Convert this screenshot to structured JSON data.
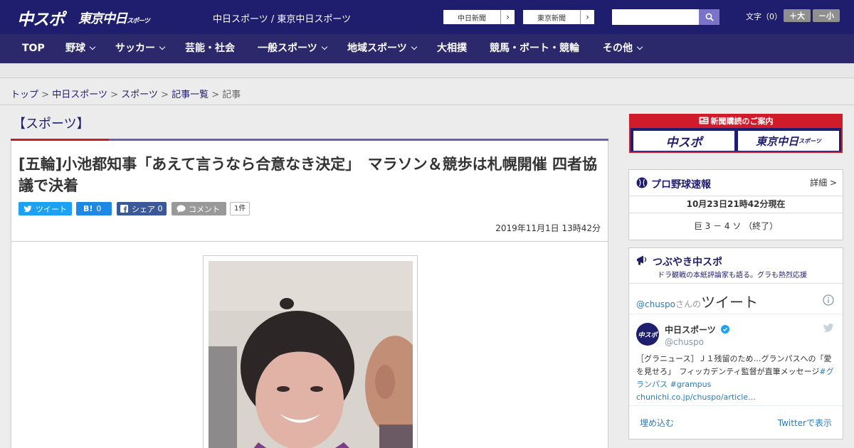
{
  "header": {
    "logo_chuspo": "中スポ",
    "logo_tokyo": "東京中日",
    "logo_tokyo_sub": "スポーツ",
    "sites_text": "中日スポーツ / 東京中日スポーツ",
    "partner_btn_1": "中日新聞",
    "partner_btn_2": "東京新聞",
    "search_placeholder": "",
    "font_size_label": "文字（0）",
    "font_up": "＋大",
    "font_down": "－小"
  },
  "nav": {
    "items": [
      {
        "label": "TOP",
        "has_chevron": false
      },
      {
        "label": "野球",
        "has_chevron": true
      },
      {
        "label": "サッカー",
        "has_chevron": true
      },
      {
        "label": "芸能・社会",
        "has_chevron": false
      },
      {
        "label": "一般スポーツ",
        "has_chevron": true
      },
      {
        "label": "地域スポーツ",
        "has_chevron": true
      },
      {
        "label": "大相撲",
        "has_chevron": false
      },
      {
        "label": "競馬・ボート・競輪",
        "has_chevron": false
      },
      {
        "label": "その他",
        "has_chevron": true
      }
    ]
  },
  "breadcrumb": {
    "items": [
      "トップ",
      "中日スポーツ",
      "スポーツ",
      "記事一覧"
    ],
    "current": "記事",
    "separator": ">"
  },
  "article": {
    "section": "【スポーツ】",
    "headline": "[五輪]小池都知事「あえて言うなら合意なき決定」　マラソン＆競歩は札幌開催 四者協議で決着",
    "share": {
      "tweet": "ツイート",
      "hatena_icon": "B!",
      "hatena_count": "0",
      "facebook_label": "シェア",
      "facebook_count": "0",
      "comment": "コメント",
      "comment_count": "1件"
    },
    "date": "2019年11月1日 13時42分"
  },
  "sidebar": {
    "ad_title": "新聞購読のご案内",
    "ad_logo_1": "中スポ",
    "ad_logo_2": "東京中日",
    "ad_logo_2_sub": "スポーツ",
    "baseball": {
      "title": "プロ野球速報",
      "detail": "詳細 >",
      "timestamp": "10月23日21時42分現在",
      "score": "巨 3 － 4 ソ （終了）"
    },
    "tsubuyaki": {
      "title": "つぶやき中スポ",
      "subtitle": "ドラ観戦の本紙評論家も語る。グラも熱烈応援",
      "account_prefix": "@chuspo",
      "account_suffix": "さんの",
      "tweets_label": "ツイート",
      "tweet_name": "中日スポーツ",
      "tweet_handle": "@chuspo",
      "tweet_avatar": "中スポ",
      "tweet_text": "［グラニュース］Ｊ１残留のため…グランパスへの「愛を見せろ」　フィッカデンティ監督が直筆メッセージ",
      "tweet_tags": "#グランパス #grampus",
      "tweet_link": "chunichi.co.jp/chuspo/article…",
      "embed": "埋め込む",
      "view_on": "Twitterで表示"
    }
  },
  "colors": {
    "brand": "#1f1d6e",
    "nav": "#2b296c",
    "accent_red": "#d01b2a",
    "twitter": "#1da1f2",
    "hatena": "#1e88e5",
    "facebook": "#3b5998"
  }
}
